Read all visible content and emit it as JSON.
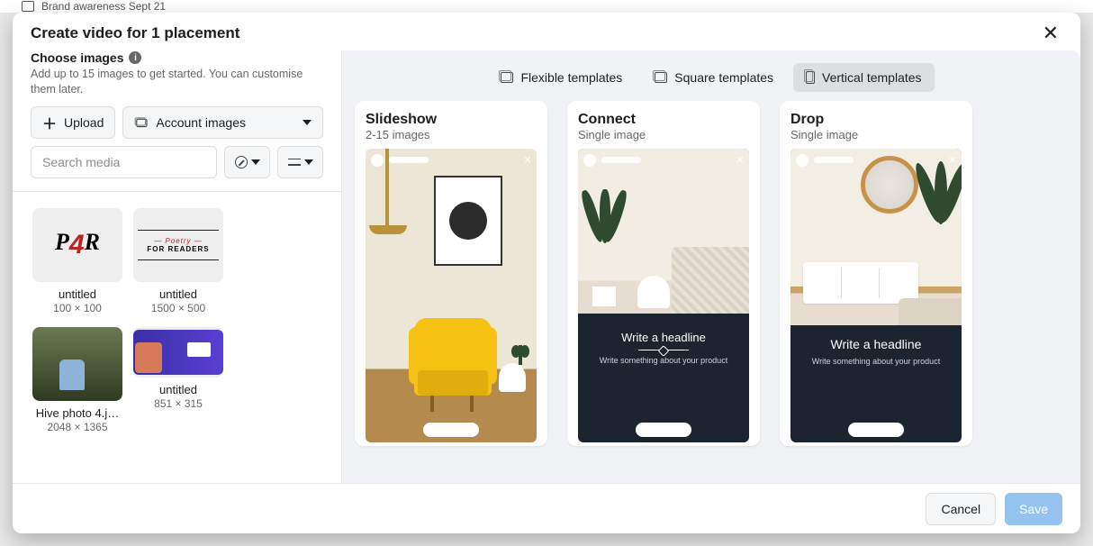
{
  "background": {
    "breadcrumb": "Brand awareness Sept 21"
  },
  "modal": {
    "title": "Create video for 1 placement",
    "choose": {
      "label": "Choose images",
      "hint": "Add up to 15 images to get started. You can customise them later."
    },
    "buttons": {
      "upload": "Upload",
      "account_images": "Account images"
    },
    "search": {
      "placeholder": "Search media",
      "value": ""
    },
    "media": [
      {
        "name": "untitled",
        "dimensions": "100 × 100"
      },
      {
        "name": "untitled",
        "dimensions": "1500 × 500"
      },
      {
        "name": "Hive photo 4.j…",
        "dimensions": "2048 × 1365"
      },
      {
        "name": "untitled",
        "dimensions": "851 × 315"
      }
    ],
    "tabs": [
      {
        "label": "Flexible templates",
        "active": false
      },
      {
        "label": "Square templates",
        "active": false
      },
      {
        "label": "Vertical templates",
        "active": true
      }
    ],
    "templates": [
      {
        "title": "Slideshow",
        "sub": "2-15 images"
      },
      {
        "title": "Connect",
        "sub": "Single image",
        "headline": "Write a headline",
        "body": "Write something about your product"
      },
      {
        "title": "Drop",
        "sub": "Single image",
        "headline": "Write a headline",
        "body": "Write something about your product"
      }
    ],
    "footer": {
      "cancel": "Cancel",
      "save": "Save"
    }
  }
}
